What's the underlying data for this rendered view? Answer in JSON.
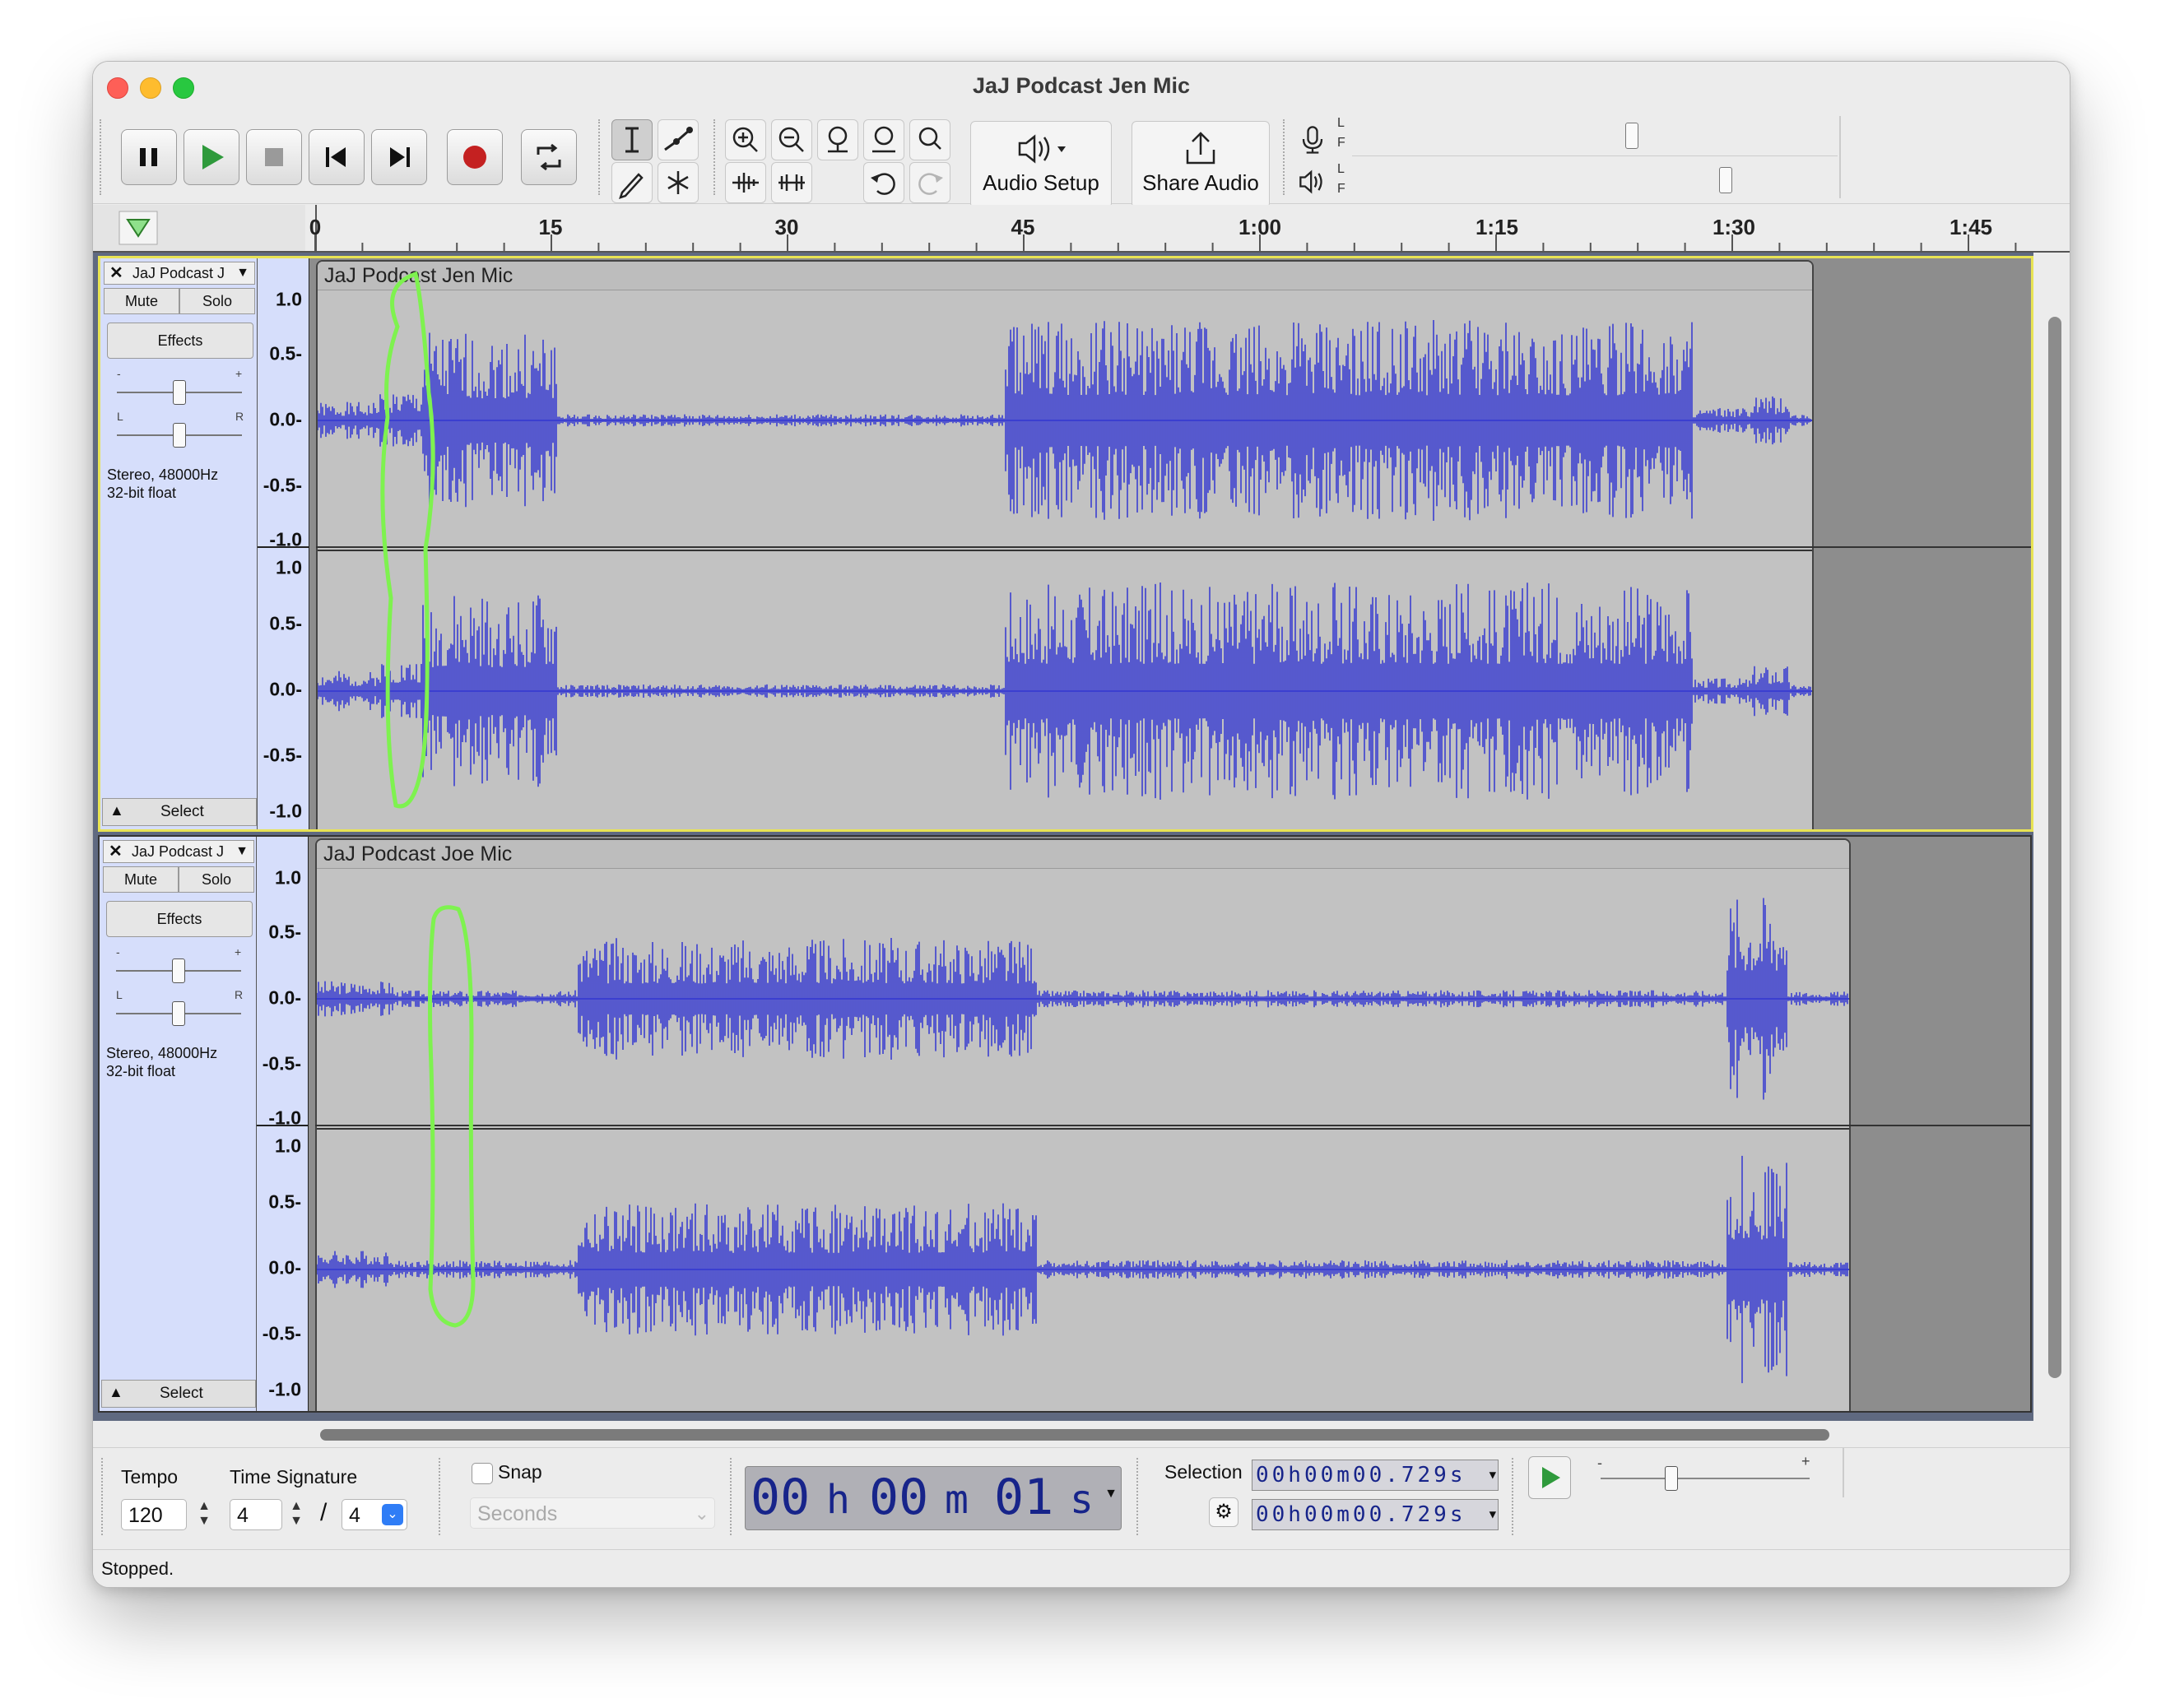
{
  "window": {
    "title": "JaJ Podcast Jen Mic"
  },
  "toolbar": {
    "audio_setup_label": "Audio Setup",
    "share_audio_label": "Share Audio",
    "meter_lr_top": [
      "L",
      "F"
    ],
    "meter_lr_bottom": [
      "L",
      "F"
    ]
  },
  "ruler": {
    "ticks": [
      "0",
      "15",
      "30",
      "45",
      "1:00",
      "1:15",
      "1:30",
      "1:45"
    ]
  },
  "tracks": [
    {
      "name": "JaJ Podcast J",
      "clip_name": "JaJ Podcast Jen Mic",
      "mute": "Mute",
      "solo": "Solo",
      "effects": "Effects",
      "gain_minus": "-",
      "gain_plus": "+",
      "pan_left": "L",
      "pan_right": "R",
      "info_line1": "Stereo, 48000Hz",
      "info_line2": "32-bit float",
      "select": "Select",
      "scale": [
        "1.0",
        "0.5-",
        "0.0-",
        "-0.5-",
        "-1.0"
      ],
      "scale_lower": [
        "1.0",
        "0.5-",
        "0.0-",
        "-0.5-",
        "-1.0"
      ],
      "selected": true
    },
    {
      "name": "JaJ Podcast J",
      "clip_name": "JaJ Podcast Joe Mic",
      "mute": "Mute",
      "solo": "Solo",
      "effects": "Effects",
      "gain_minus": "-",
      "gain_plus": "+",
      "pan_left": "L",
      "pan_right": "R",
      "info_line1": "Stereo, 48000Hz",
      "info_line2": "32-bit float",
      "select": "Select",
      "scale": [
        "1.0",
        "0.5-",
        "0.0-",
        "-0.5-",
        "-1.0"
      ],
      "scale_lower": [
        "1.0",
        "0.5-",
        "0.0-",
        "-0.5-",
        "-1.0"
      ],
      "selected": false
    }
  ],
  "bottom": {
    "tempo_label": "Tempo",
    "tempo_value": "120",
    "time_signature_label": "Time Signature",
    "ts_numerator": "4",
    "ts_slash": "/",
    "ts_denominator": "4",
    "snap_label": "Snap",
    "snap_unit": "Seconds",
    "time_display": {
      "h": "00",
      "h_unit": "h",
      "m": "00",
      "m_unit": "m",
      "s": "01",
      "s_unit": "s"
    },
    "selection_label": "Selection",
    "selection_start": "00h00m00.729s",
    "selection_end": "00h00m00.729s"
  },
  "status": "Stopped.",
  "colors": {
    "waveform": "#3b3fd0",
    "annotation": "#7ef24f",
    "selected_border": "#e8e354"
  }
}
